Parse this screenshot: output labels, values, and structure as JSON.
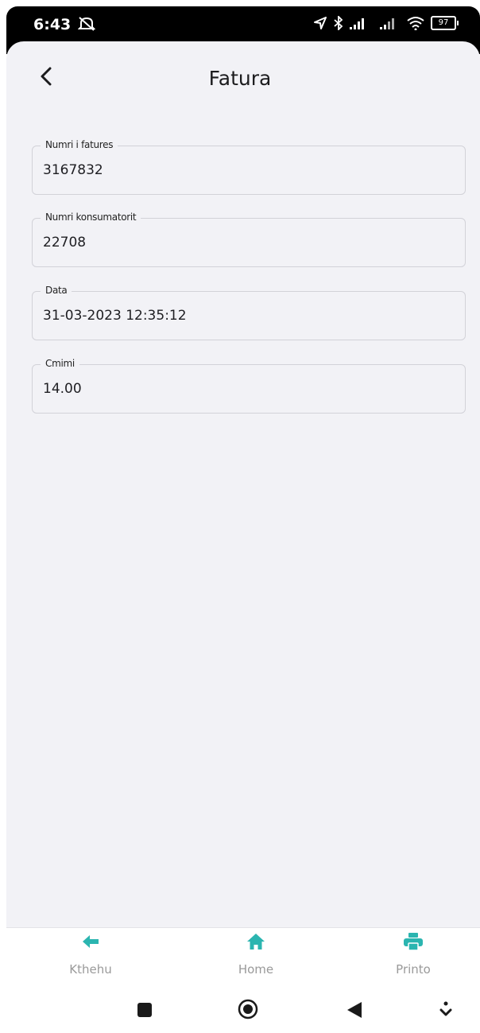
{
  "status_bar": {
    "time": "6:43",
    "battery": "97"
  },
  "header": {
    "title": "Fatura"
  },
  "fields": [
    {
      "label": "Numri i fatures",
      "value": "3167832"
    },
    {
      "label": "Numri konsumatorit",
      "value": "22708"
    },
    {
      "label": "Data",
      "value": "31-03-2023 12:35:12"
    },
    {
      "label": "Cmimi",
      "value": "14.00"
    }
  ],
  "bottom_nav": {
    "accent_color": "#2bb5b0",
    "items": [
      {
        "label": "Kthehu",
        "icon": "arrow-left-icon"
      },
      {
        "label": "Home",
        "icon": "home-icon"
      },
      {
        "label": "Printo",
        "icon": "printer-icon"
      }
    ]
  },
  "system_nav": {
    "buttons": [
      "recents-square-icon",
      "home-circle-icon",
      "back-triangle-icon",
      "gesture-arrow-icon"
    ]
  }
}
